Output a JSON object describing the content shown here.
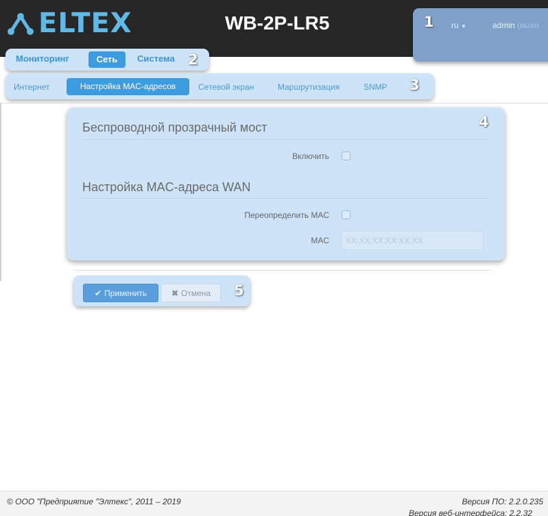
{
  "header": {
    "brand": "ELTEX",
    "device_name": "WB-2P-LR5",
    "lang": "ru",
    "user": "admin",
    "logout": "(выхо"
  },
  "callouts": [
    "1",
    "2",
    "3",
    "4",
    "5"
  ],
  "main_nav": {
    "items": [
      "Мониторинг",
      "Сеть",
      "Система"
    ],
    "active": "Сеть"
  },
  "sub_nav": {
    "items": [
      "Интернет",
      "Настройка MAC-адресов",
      "Сетевой экран",
      "Маршрутизация",
      "SNMP"
    ],
    "active": "Настройка MAC-адресов"
  },
  "form": {
    "section1_title": "Беспроводной прозрачный мост",
    "enable_label": "Включить",
    "enable_checked": false,
    "section2_title": "Настройка MAC-адреса WAN",
    "override_label": "Переопределить MAC",
    "override_checked": false,
    "mac_label": "MAC",
    "mac_placeholder": "XX:XX:XX:XX:XX:XX",
    "mac_value": ""
  },
  "buttons": {
    "apply": "Применить",
    "cancel": "Отмена"
  },
  "footer": {
    "copyright": "© ООО \"Предприятие \"Элтекс\", 2011 – 2019",
    "fw_version": "Версия ПО: 2.2.0.235",
    "web_version": "Версия веб-интерфейса: 2.2.32"
  },
  "colors": {
    "header_bg": "#272727",
    "brand": "#5fb8e6",
    "accent": "#3d9be0",
    "highlight_bg": "#cde3f7"
  },
  "icons": {
    "logo": "eltex-logo-icon",
    "dropdown": "caret-down-icon",
    "apply": "check-icon",
    "cancel": "close-icon"
  }
}
